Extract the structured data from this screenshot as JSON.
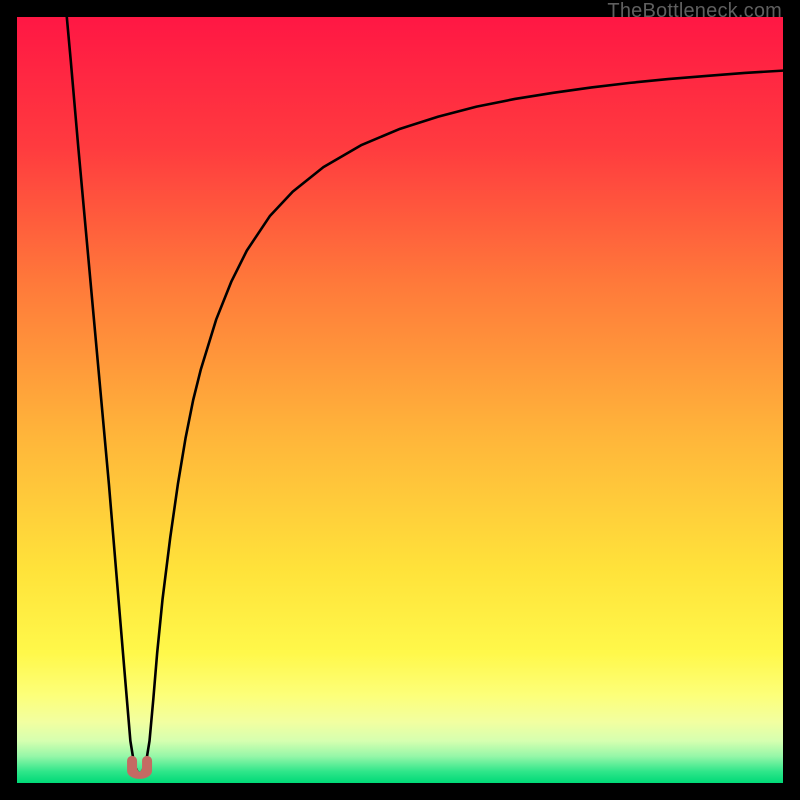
{
  "attribution": "TheBottleneck.com",
  "chart_data": {
    "type": "line",
    "title": "",
    "xlabel": "",
    "ylabel": "",
    "xlim": [
      0,
      100
    ],
    "ylim": [
      0,
      100
    ],
    "x": [
      6.5,
      7,
      8,
      9,
      10,
      11,
      12,
      13,
      14,
      14.8,
      15.3,
      15.8,
      16.2,
      16.8,
      17.3,
      17.8,
      18.3,
      19,
      20,
      21,
      22,
      23,
      24,
      26,
      28,
      30,
      33,
      36,
      40,
      45,
      50,
      55,
      60,
      65,
      70,
      75,
      80,
      85,
      90,
      95,
      100
    ],
    "values": [
      100,
      94.5,
      83,
      72,
      61,
      50,
      39,
      27,
      15,
      5.5,
      2.4,
      1.3,
      1.3,
      2.4,
      5.5,
      11,
      17,
      24,
      32,
      39,
      45,
      50,
      54,
      60.5,
      65.5,
      69.5,
      74,
      77.2,
      80.4,
      83.3,
      85.4,
      87,
      88.3,
      89.3,
      90.1,
      90.8,
      91.4,
      91.9,
      92.3,
      92.7,
      93
    ],
    "marker": {
      "shape": "u",
      "x_center": 16,
      "y_baseline": 1.0,
      "color": "#c46a63"
    },
    "background": {
      "type": "vertical-gradient",
      "stops": [
        {
          "pos": 0.0,
          "color": "#ff1744"
        },
        {
          "pos": 0.17,
          "color": "#ff3b3f"
        },
        {
          "pos": 0.35,
          "color": "#ff7a3a"
        },
        {
          "pos": 0.55,
          "color": "#ffb63a"
        },
        {
          "pos": 0.72,
          "color": "#ffe23a"
        },
        {
          "pos": 0.83,
          "color": "#fff84a"
        },
        {
          "pos": 0.885,
          "color": "#fdff79"
        },
        {
          "pos": 0.92,
          "color": "#f2ffa0"
        },
        {
          "pos": 0.945,
          "color": "#d6ffb0"
        },
        {
          "pos": 0.965,
          "color": "#96f7a8"
        },
        {
          "pos": 0.985,
          "color": "#2fe68a"
        },
        {
          "pos": 1.0,
          "color": "#00d977"
        }
      ]
    }
  }
}
